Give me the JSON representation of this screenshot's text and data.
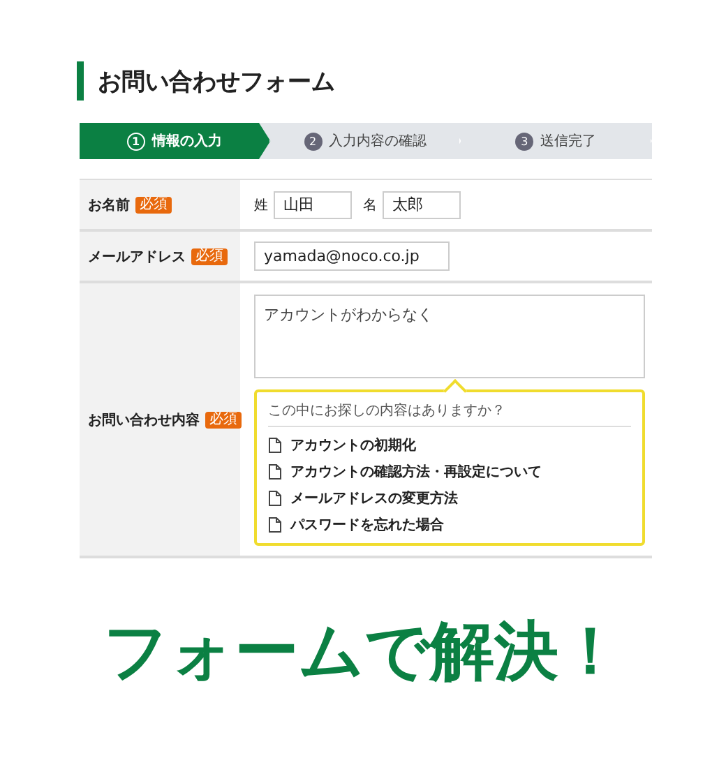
{
  "title": "お問い合わせフォーム",
  "steps": [
    {
      "number": "1",
      "label": "情報の入力",
      "selected": true
    },
    {
      "number": "2",
      "label": "入力内容の確認",
      "selected": false
    },
    {
      "number": "3",
      "label": "送信完了",
      "selected": false
    }
  ],
  "rows": [
    {
      "kind": "name",
      "label": "お名前",
      "badge": "必須",
      "fields": [
        {
          "prefix": "姓",
          "value": "山田"
        },
        {
          "prefix": "名",
          "value": "太郎"
        }
      ]
    },
    {
      "kind": "email",
      "label": "メールアドレス",
      "badge": "必須",
      "value": "yamada@noco.co.jp"
    },
    {
      "kind": "message",
      "label": "お問い合わせ内容",
      "badge": "必須",
      "value": "アカウントがわからなく",
      "suggest": {
        "heading": "この中にお探しの内容はありますか？",
        "items": [
          "アカウントの初期化",
          "アカウントの確認方法・再設定について",
          "メールアドレスの変更方法",
          "パスワードを忘れた場合"
        ]
      }
    }
  ],
  "caption": "フォームで解決！"
}
